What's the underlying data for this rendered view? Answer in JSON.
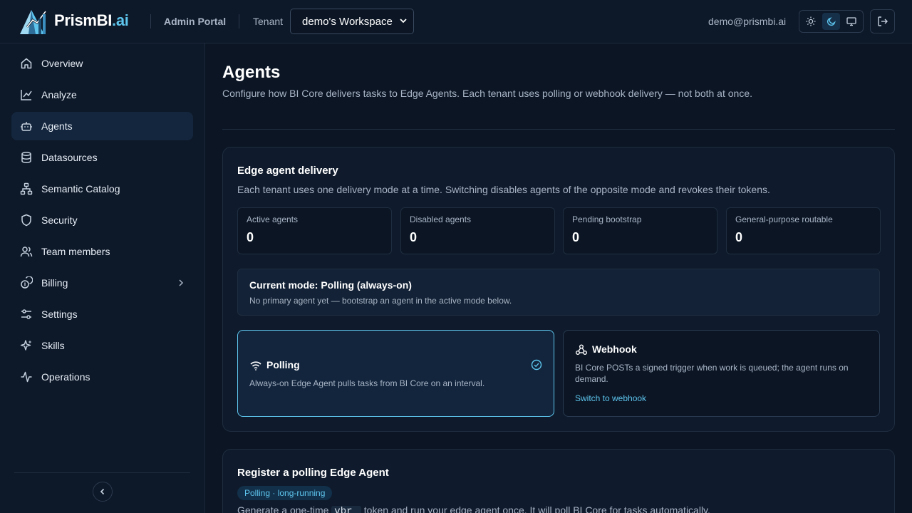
{
  "header": {
    "brand_main": "PrismBI",
    "brand_suffix": ".ai",
    "portal": "Admin Portal",
    "tenant_label": "Tenant",
    "tenant_value": "demo's Workspace",
    "email": "demo@prismbi.ai",
    "accent": "#5ec6ee"
  },
  "sidebar": {
    "items": [
      {
        "label": "Overview",
        "icon": "home-icon"
      },
      {
        "label": "Analyze",
        "icon": "chart-line-icon"
      },
      {
        "label": "Agents",
        "icon": "bot-icon",
        "active": true
      },
      {
        "label": "Datasources",
        "icon": "database-icon"
      },
      {
        "label": "Semantic Catalog",
        "icon": "network-icon"
      },
      {
        "label": "Security",
        "icon": "shield-icon"
      },
      {
        "label": "Team members",
        "icon": "users-icon"
      },
      {
        "label": "Billing",
        "icon": "coins-icon"
      },
      {
        "label": "Settings",
        "icon": "sliders-icon"
      },
      {
        "label": "Skills",
        "icon": "sparkles-icon"
      },
      {
        "label": "Operations",
        "icon": "activity-icon"
      }
    ]
  },
  "main": {
    "title": "Agents",
    "description": "Configure how BI Core delivers tasks to Edge Agents. Each tenant uses polling or webhook delivery — not both at once."
  },
  "delivery": {
    "title": "Edge agent delivery",
    "subtitle": "Each tenant uses one delivery mode at a time. Switching disables agents of the opposite mode and revokes their tokens.",
    "stats": [
      {
        "label": "Active agents",
        "value": "0"
      },
      {
        "label": "Disabled agents",
        "value": "0"
      },
      {
        "label": "Pending bootstrap",
        "value": "0"
      },
      {
        "label": "General-purpose routable",
        "value": "0"
      }
    ],
    "current_mode_title": "Current mode: Polling (always-on)",
    "current_mode_desc": "No primary agent yet — bootstrap an agent in the active mode below.",
    "polling": {
      "title": "Polling",
      "desc": "Always-on Edge Agent pulls tasks from BI Core on an interval."
    },
    "webhook": {
      "title": "Webhook",
      "desc": "BI Core POSTs a signed trigger when work is queued; the agent runs on demand.",
      "link": "Switch to webhook"
    }
  },
  "register": {
    "title": "Register a polling Edge Agent",
    "badge": "Polling · long-running",
    "desc_before": "Generate a one-time",
    "desc_code": "vbr_",
    "desc_after": "token and run your edge agent once. It will poll BI Core for tasks automatically."
  }
}
